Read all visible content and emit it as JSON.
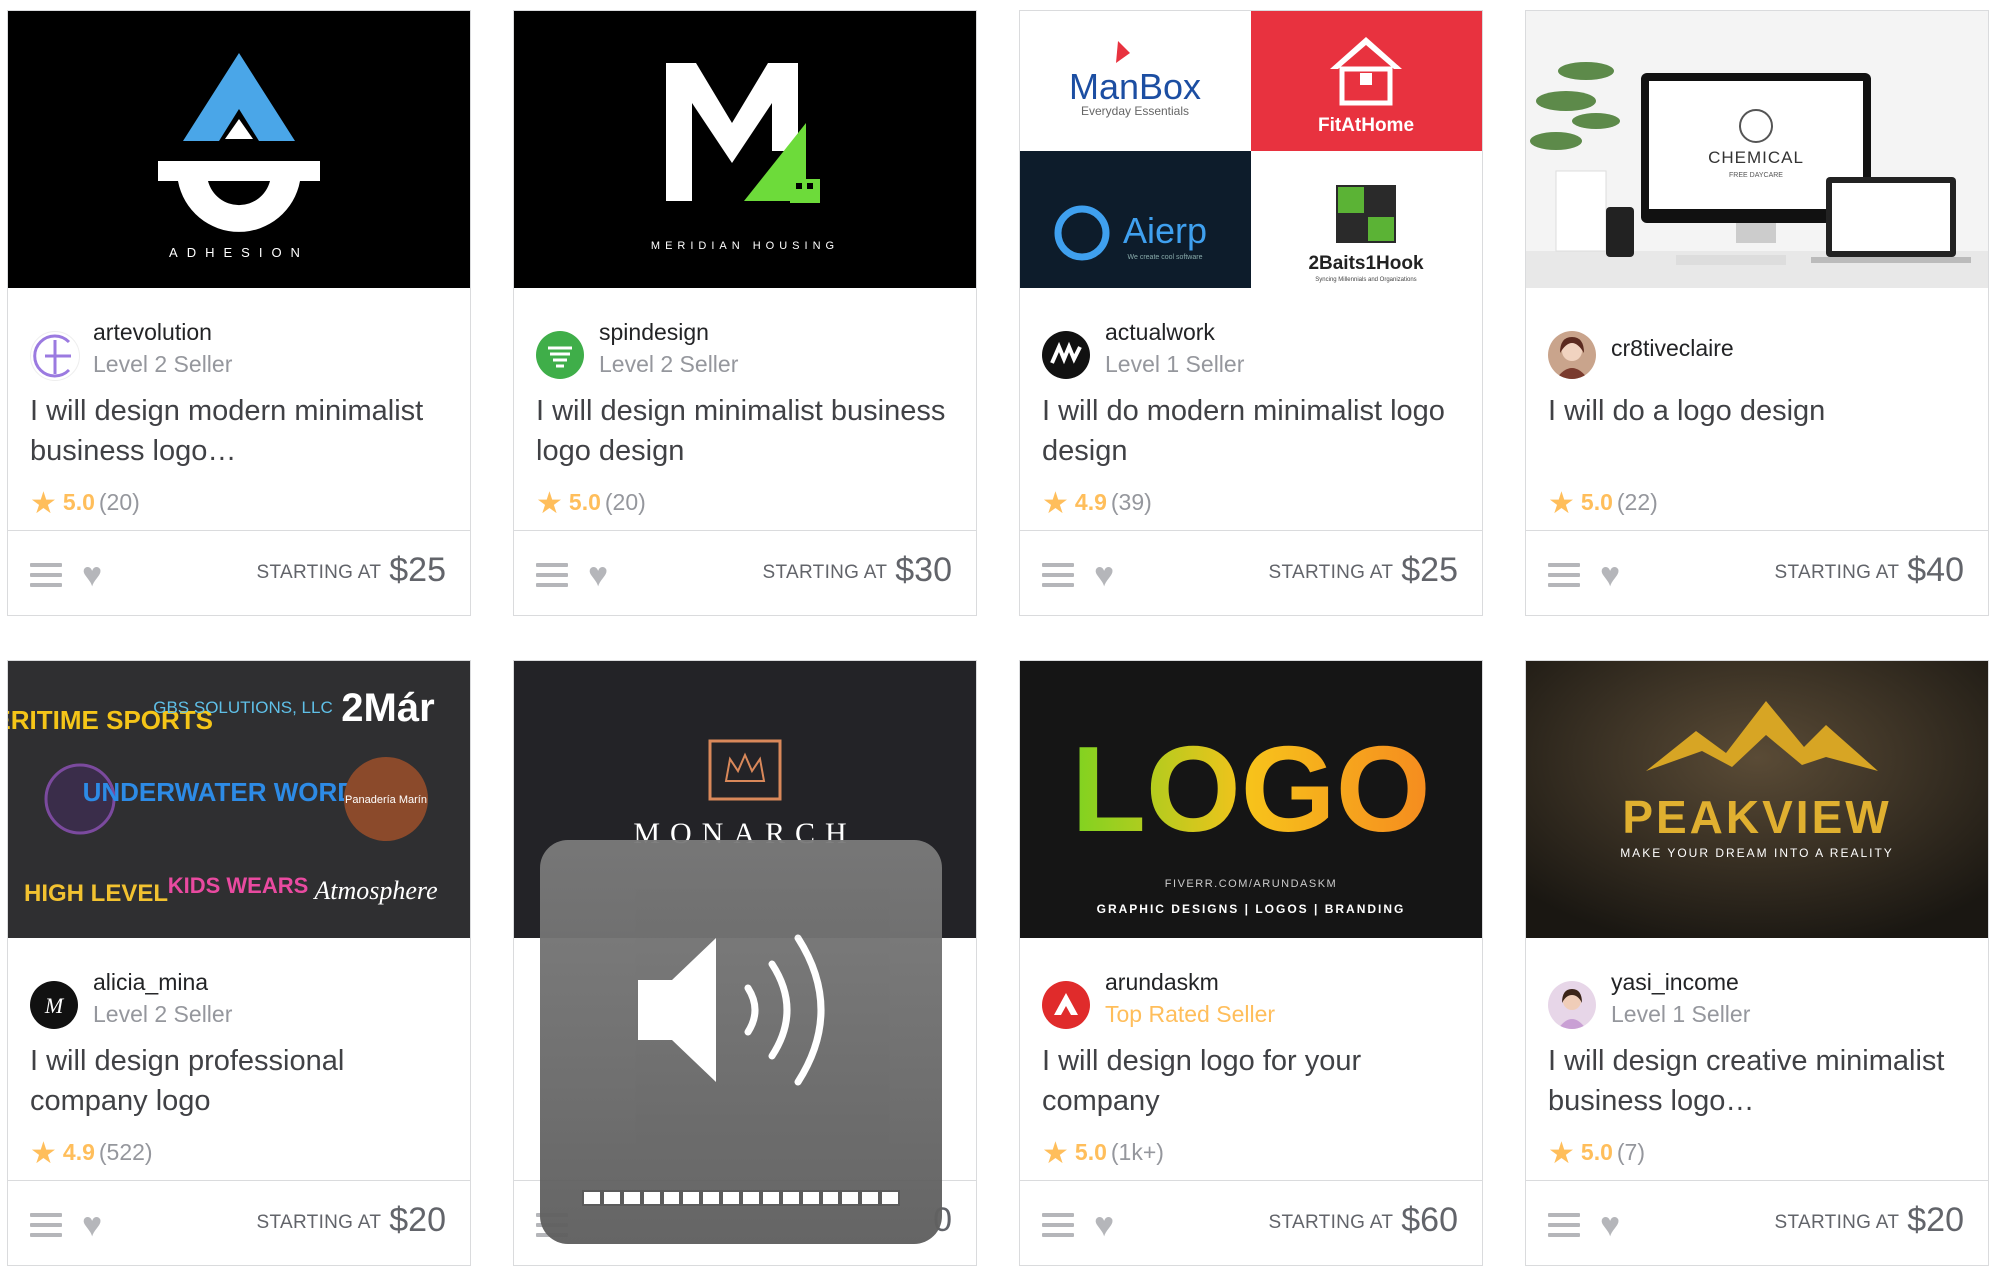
{
  "gigs": [
    {
      "seller": "artevolution",
      "level": "Level 2 Seller",
      "title": "I will design modern minimalist business logo…",
      "score": "5.0",
      "count": "(20)",
      "price_label": "STARTING AT",
      "price": "$25",
      "thumb_text": "ADHESION"
    },
    {
      "seller": "spindesign",
      "level": "Level 2 Seller",
      "title": "I will design minimalist business logo design",
      "score": "5.0",
      "count": "(20)",
      "price_label": "STARTING AT",
      "price": "$30",
      "thumb_text": "MERIDIAN HOUSING"
    },
    {
      "seller": "actualwork",
      "level": "Level 1 Seller",
      "title": "I will do modern minimalist logo design",
      "score": "4.9",
      "count": "(39)",
      "price_label": "STARTING AT",
      "price": "$25",
      "thumb_text": [
        "ManBox",
        "Everyday Essentials",
        "FitAtHome",
        "Aierp",
        "We create cool software",
        "2Baits1Hook",
        "Syncing Millennials and Organizations"
      ]
    },
    {
      "seller": "cr8tiveclaire",
      "level": "",
      "title": "I will do a logo design",
      "score": "5.0",
      "count": "(22)",
      "price_label": "STARTING AT",
      "price": "$40",
      "thumb_text": [
        "CHEMICAL",
        "FREE DAYCARE"
      ]
    },
    {
      "seller": "alicia_mina",
      "level": "Level 2 Seller",
      "title": "I will design professional company logo",
      "score": "4.9",
      "count": "(522)",
      "price_label": "STARTING AT",
      "price": "$20",
      "thumb_text": [
        "AMERITIME SPORTS",
        "GBS SOLUTIONS, LLC",
        "2Már",
        "UNDERWATER WORDS",
        "Panadería Marín",
        "HIGH LEVEL",
        "KIDS WEARS",
        "Atmosphere"
      ]
    },
    {
      "seller": "",
      "level": "",
      "title": "",
      "score": "",
      "count": "",
      "price_label": "",
      "price": "",
      "thumb_text": "MONARCH"
    },
    {
      "seller": "arundaskm",
      "level": "Top Rated Seller",
      "title": "I will design logo for your company",
      "score": "5.0",
      "count": "(1k+)",
      "price_label": "STARTING AT",
      "price": "$60",
      "thumb_text": [
        "LOGO",
        "FIVERR.COM/ARUNDASKM",
        "GRAPHIC DESIGNS | LOGOS | BRANDING"
      ]
    },
    {
      "seller": "yasi_income",
      "level": "Level 1 Seller",
      "title": "I will design creative minimalist business logo…",
      "score": "5.0",
      "count": "(7)",
      "price_label": "STARTING AT",
      "price": "$20",
      "thumb_text": [
        "PEAKVIEW",
        "MAKE YOUR DREAM INTO A REALITY"
      ]
    }
  ],
  "hidden_fragments": {
    "price_tail": "0"
  },
  "overlay": {
    "name": "volume-hud",
    "level": 1.0,
    "segments": 16
  }
}
